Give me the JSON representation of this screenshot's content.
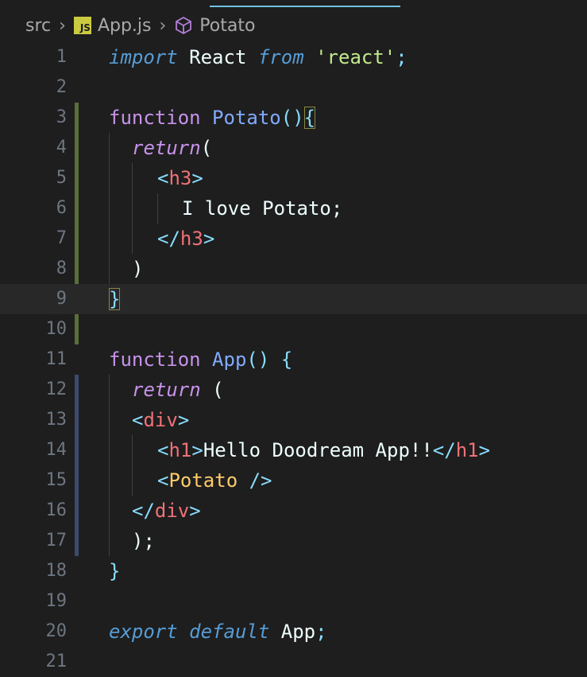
{
  "breadcrumb": {
    "folder": "src",
    "file_icon_text": "JS",
    "file": "App.js",
    "symbol_icon": "cube-icon",
    "symbol": "Potato"
  },
  "editor": {
    "current_line": 9,
    "lines": [
      {
        "n": "1"
      },
      {
        "n": "2"
      },
      {
        "n": "3"
      },
      {
        "n": "4"
      },
      {
        "n": "5"
      },
      {
        "n": "6"
      },
      {
        "n": "7"
      },
      {
        "n": "8"
      },
      {
        "n": "9"
      },
      {
        "n": "10"
      },
      {
        "n": "11"
      },
      {
        "n": "12"
      },
      {
        "n": "13"
      },
      {
        "n": "14"
      },
      {
        "n": "15"
      },
      {
        "n": "16"
      },
      {
        "n": "17"
      },
      {
        "n": "18"
      },
      {
        "n": "19"
      },
      {
        "n": "20"
      },
      {
        "n": "21"
      }
    ],
    "tokens": {
      "l1_import": "import",
      "l1_react": "React",
      "l1_from": "from",
      "l1_str": "'react'",
      "l1_semi": ";",
      "l3_function": "function",
      "l3_name": "Potato",
      "l3_parens": "()",
      "l3_brace": "{",
      "l4_return": "return",
      "l4_paren": "(",
      "l5_open": "<",
      "l5_tag": "h3",
      "l5_close": ">",
      "l6_text": "I love Potato;",
      "l7_open": "</",
      "l7_tag": "h3",
      "l7_close": ">",
      "l8_paren": ")",
      "l9_brace": "}",
      "l11_function": "function",
      "l11_name": "App",
      "l11_parens": "()",
      "l11_brace": "{",
      "l12_return": "return",
      "l12_paren": "(",
      "l13_open": "<",
      "l13_tag": "div",
      "l13_close": ">",
      "l14_open": "<",
      "l14_tag": "h1",
      "l14_close": ">",
      "l14_text": "Hello Doodream App!!",
      "l14_eopen": "</",
      "l14_etag": "h1",
      "l14_eclose": ">",
      "l15_open": "<",
      "l15_comp": "Potato",
      "l15_close": "/>",
      "l16_open": "</",
      "l16_tag": "div",
      "l16_close": ">",
      "l17_end": ");",
      "l18_brace": "}",
      "l20_export": "export",
      "l20_default": "default",
      "l20_app": "App",
      "l20_semi": ";"
    }
  },
  "colors": {
    "background": "#1e1e1e",
    "gutter_modified": "#5a6e3a",
    "gutter_added": "#3b4a6e"
  }
}
